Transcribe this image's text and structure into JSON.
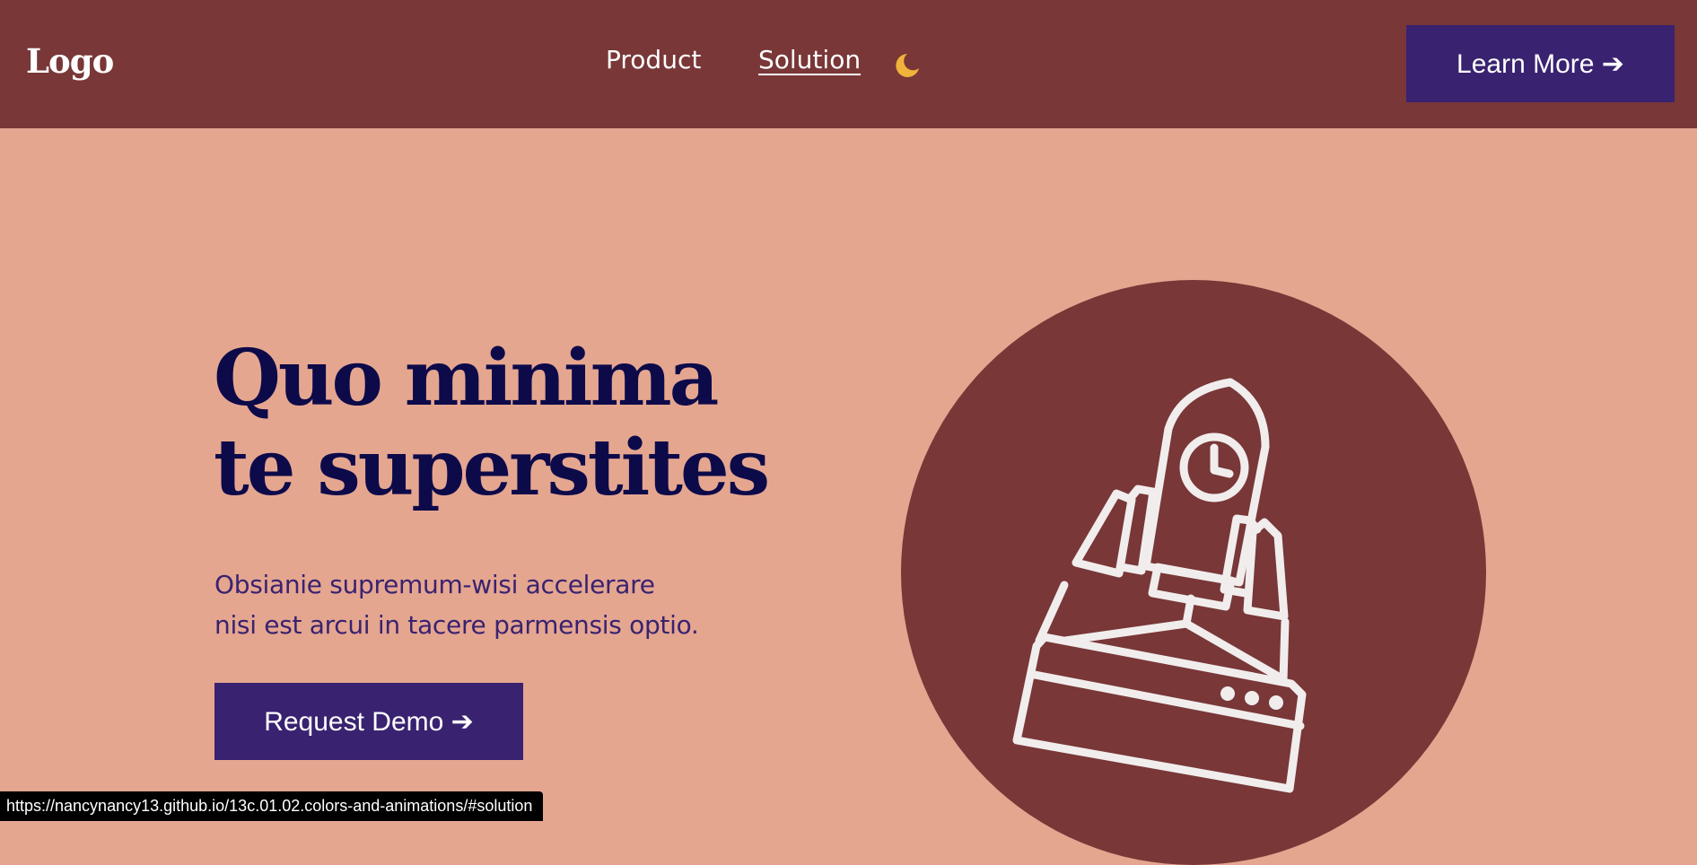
{
  "header": {
    "logo": "Logo",
    "nav": [
      {
        "label": "Product"
      },
      {
        "label": "Solution"
      }
    ],
    "theme_icon": "moon-icon",
    "cta_label": "Learn More ➔"
  },
  "hero": {
    "title_line1": "Quo minima",
    "title_line2": "te superstites",
    "subtitle_line1": "Obsianie supremum-wisi accelerare",
    "subtitle_line2": "nisi est arcui in tacere parmensis optio.",
    "cta_label": "Request Demo ➔",
    "illustration_icon": "rocket-icon"
  },
  "status_bar": {
    "url": "https://nancynancy13.github.io/13c.01.02.colors-and-animations/#solution"
  },
  "colors": {
    "header_bg": "#793738",
    "page_bg": "#e5a690",
    "button_bg": "#392270",
    "title_color": "#0d0a4a",
    "moon": "#f0b23a"
  }
}
